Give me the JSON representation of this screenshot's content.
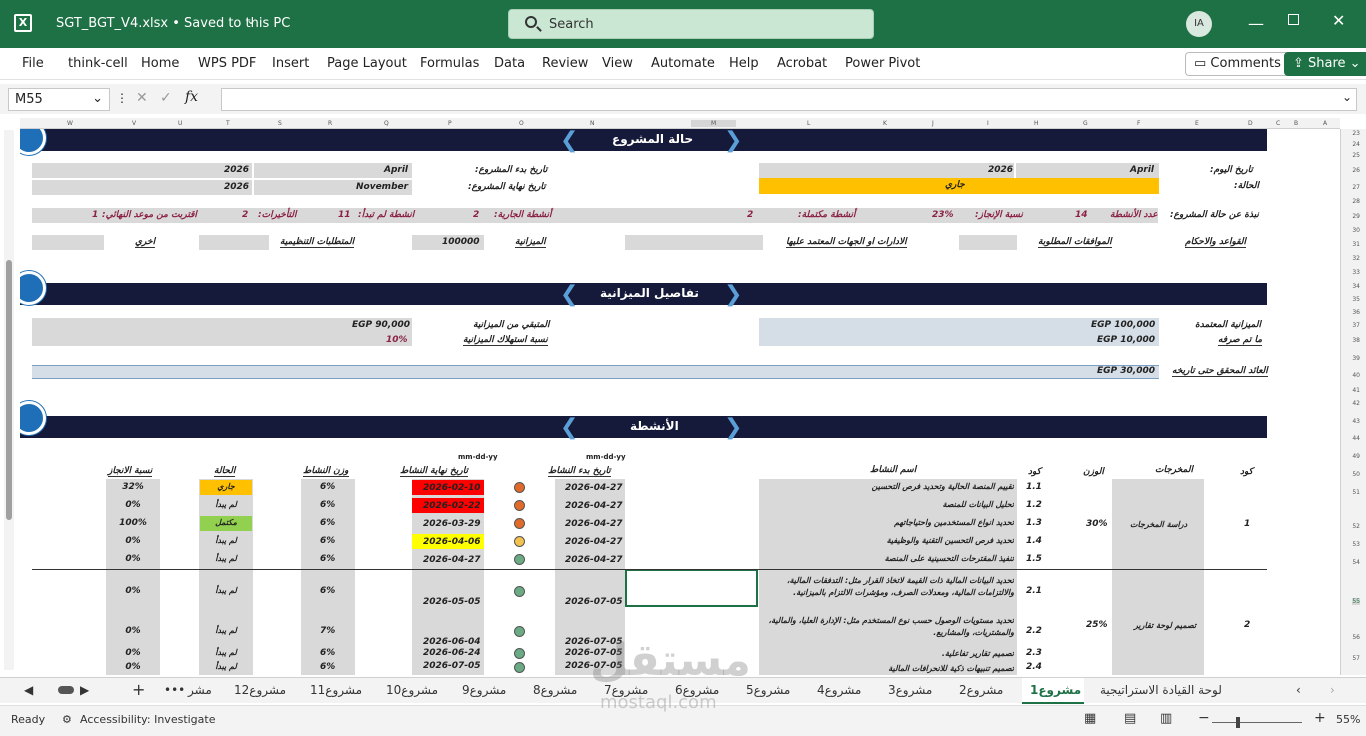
{
  "titlebar": {
    "file": "SGT_BGT_V4.xlsx  •  Saved to this PC",
    "search": "Search",
    "avatar": "IA"
  },
  "ribbon": {
    "tabs": [
      "File",
      "think-cell",
      "Home",
      "WPS PDF",
      "Insert",
      "Page Layout",
      "Formulas",
      "Data",
      "Review",
      "View",
      "Automate",
      "Help",
      "Acrobat",
      "Power Pivot"
    ],
    "comments": "Comments",
    "share": "Share"
  },
  "formula": {
    "namebox": "M55",
    "fx": "fx"
  },
  "columns": [
    "W",
    "V",
    "U",
    "T",
    "S",
    "R",
    "Q",
    "P",
    "O",
    "N",
    "M",
    "L",
    "K",
    "J",
    "I",
    "H",
    "G",
    "F",
    "E",
    "D",
    "C",
    "B",
    "A"
  ],
  "rows": [
    "23",
    "24",
    "25",
    "26",
    "27",
    "28",
    "29",
    "30",
    "31",
    "32",
    "33",
    "34",
    "35",
    "36",
    "37",
    "38",
    "39",
    "40",
    "41",
    "42",
    "43",
    "44",
    "49",
    "50",
    "51",
    "52",
    "53",
    "54",
    "55",
    "56",
    "57"
  ],
  "status_section": {
    "title": "حالة المشروع",
    "today_label": "تاريخ اليوم:",
    "today_month": "April",
    "today_year": "2026",
    "state_label": "الحالة:",
    "state_value": "جاري",
    "start_label": "تاريخ بدء المشروع:",
    "start_month": "April",
    "start_year": "2026",
    "end_label": "تاريخ نهاية المشروع:",
    "end_month": "November",
    "end_year": "2026",
    "overview_label": "نبذة عن حالة المشروع:",
    "count_label": "عدد الأنشطة",
    "count_value": "14",
    "progress_label": "نسبة الإنجاز:",
    "progress_value": "23%",
    "done_label": "أنشطة مكتملة:",
    "done_value": "2",
    "running_label": "أنشطة الجارية:",
    "running_value": "2",
    "notstarted_label": "انشطة لم تبدأ:",
    "notstarted_value": "11",
    "delays_label": "التأخيرات:",
    "delays_value": "2",
    "near_label": "اقتربت من موعد النهائي:",
    "near_value": "1",
    "rules_label": "القواعد والاحكام",
    "approvals_label": "الموافقات المطلوبة",
    "depts_label": "الادارات او الجهات المعتمد عليها",
    "budget_label": "الميزانية",
    "budget_value": "100000",
    "reg_label": "المتطلبات التنظيمية",
    "other_label": "اخري"
  },
  "budget_section": {
    "title": "تفاصيل الميزانية",
    "approved_label": "الميزانية المعتمدة",
    "approved_value": "EGP 100,000",
    "spent_label": "ما تم صرفه",
    "spent_value": "EGP 10,000",
    "remaining_label": "المتبقي من الميزانية",
    "remaining_value": "EGP 90,000",
    "consumption_label": "نسبة استهلاك الميزانية",
    "consumption_value": "10%",
    "return_label": "العائد المحقق حتى تاريخه",
    "return_value": "EGP 30,000"
  },
  "activities": {
    "title": "الأنشطة",
    "headers": {
      "code": "كود",
      "outputs": "المخرجات",
      "weight": "الوزن",
      "code2": "كود",
      "name": "اسم النشاط",
      "start": "تاريخ بدء النشاط",
      "end": "تاريخ نهاية النشاط",
      "act_weight": "وزن النشاط",
      "state": "الحالة",
      "progress": "نسبة الانجاز",
      "fmt": "mm-dd-yy"
    },
    "groups": [
      {
        "code": "1",
        "output": "دراسة المخرجات",
        "weight": "30%"
      },
      {
        "code": "2",
        "output": "تصميم لوحة تقارير",
        "weight": "25%"
      }
    ],
    "rows": [
      {
        "code": "1.1",
        "name": "تقييم المنصة الحالية وتحديد فرص التحسين",
        "start": "2026-04-27",
        "end": "2026-02-10",
        "endColor": "#ff0000",
        "dot": "#e06a2a",
        "weight": "6%",
        "state": "جاري",
        "stateColor": "#ffc000",
        "progress": "32%"
      },
      {
        "code": "1.2",
        "name": "تحليل البيانات للمنصة",
        "start": "2026-04-27",
        "end": "2026-02-22",
        "endColor": "#ff0000",
        "dot": "#e06a2a",
        "weight": "6%",
        "state": "لم يبدأ",
        "stateColor": "#d9d9d9",
        "progress": "0%"
      },
      {
        "code": "1.3",
        "name": "تحديد انواع المستخدمين واحتياجاتهم",
        "start": "2026-04-27",
        "end": "2026-03-29",
        "endColor": "#d9d9d9",
        "dot": "#e06a2a",
        "weight": "6%",
        "state": "مكتمل",
        "stateColor": "#92d050",
        "progress": "100%"
      },
      {
        "code": "1.4",
        "name": "تحديد فرص التحسين التقنية والوظيفية",
        "start": "2026-04-27",
        "end": "2026-04-06",
        "endColor": "#ffff00",
        "dot": "#f2c14e",
        "weight": "6%",
        "state": "لم يبدأ",
        "stateColor": "#d9d9d9",
        "progress": "0%"
      },
      {
        "code": "1.5",
        "name": "تنفيذ المقترحات التحسينية على المنصة",
        "start": "2026-04-27",
        "end": "2026-04-27",
        "endColor": "#d9d9d9",
        "dot": "#6aaa84",
        "weight": "6%",
        "state": "لم يبدأ",
        "stateColor": "#d9d9d9",
        "progress": "0%"
      },
      {
        "code": "2.1",
        "name": "تحديد البيانات المالية ذات القيمة لاتخاذ القرار مثل: التدفقات المالية، والالتزامات المالية، ومعدلات الصرف، ومؤشرات الالتزام بالميزانية.",
        "start": "2026-07-05",
        "end": "2026-05-05",
        "endColor": "#d9d9d9",
        "dot": "#6aaa84",
        "weight": "6%",
        "state": "لم يبدأ",
        "stateColor": "#d9d9d9",
        "progress": "0%"
      },
      {
        "code": "2.2",
        "name": "تحديد مستويات الوصول حسب نوع المستخدم مثل: الإدارة العليا، والمالية، والمشتريات، والمشاريع.",
        "start": "2026-07-05",
        "end": "2026-06-04",
        "endColor": "#d9d9d9",
        "dot": "#6aaa84",
        "weight": "7%",
        "state": "لم يبدأ",
        "stateColor": "#d9d9d9",
        "progress": "0%"
      },
      {
        "code": "2.3",
        "name": "تصميم تقارير تفاعلية.",
        "start": "2026-07-05",
        "end": "2026-06-24",
        "endColor": "#d9d9d9",
        "dot": "#6aaa84",
        "weight": "6%",
        "state": "لم يبدأ",
        "stateColor": "#d9d9d9",
        "progress": "0%"
      },
      {
        "code": "2.4",
        "name": "تصميم تنبيهات ذكية للانحرافات المالية",
        "start": "2026-07-05",
        "end": "2026-07-05",
        "endColor": "#d9d9d9",
        "dot": "#6aaa84",
        "weight": "6%",
        "state": "لم يبدأ",
        "stateColor": "#d9d9d9",
        "progress": "0%"
      }
    ]
  },
  "sheet_tabs": [
    "لوحة القيادة الاستراتيجية",
    "مشروع1",
    "مشروع2",
    "مشروع3",
    "مشروع4",
    "مشروع5",
    "مشروع6",
    "مشروع7",
    "مشروع8",
    "مشروع9",
    "مشروع10",
    "مشروع11",
    "مشروع12",
    "مشر"
  ],
  "statusbar": {
    "ready": "Ready",
    "accessibility": "Accessibility: Investigate",
    "zoom": "55%"
  },
  "watermark": {
    "ar": "مستقل",
    "en": "mostaql.com"
  }
}
